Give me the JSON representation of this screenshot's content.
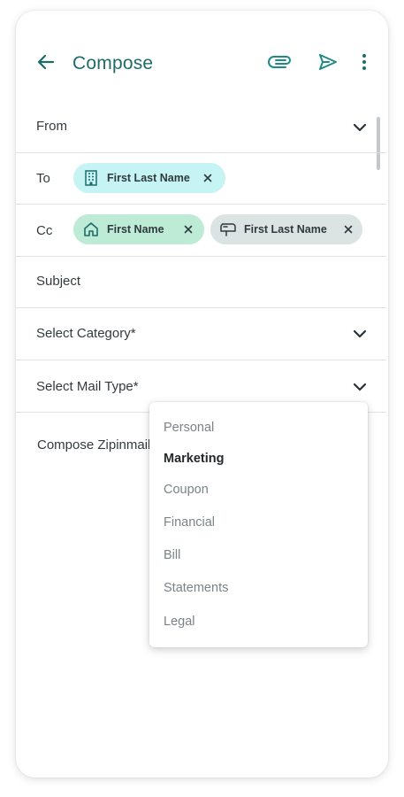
{
  "header": {
    "title": "Compose",
    "back_icon": "arrow-left-icon",
    "attach_icon": "paperclip-icon",
    "send_icon": "send-icon",
    "more_icon": "more-vertical-icon",
    "accent_color": "#1f8a86"
  },
  "fields": {
    "from": {
      "label": "From"
    },
    "to": {
      "label": "To",
      "chips": [
        {
          "name": "First Last Name",
          "icon": "building-icon",
          "color": "#c6f3f4"
        }
      ]
    },
    "cc": {
      "label": "Cc",
      "chips": [
        {
          "name": "First Name",
          "icon": "home-icon",
          "color": "#bdebd6"
        },
        {
          "name": "First Last Name",
          "icon": "mailbox-icon",
          "color": "#dbe3e3"
        }
      ]
    },
    "subject": {
      "label": "Subject"
    },
    "category": {
      "label": "Select Category*"
    },
    "mail_type": {
      "label": "Select Mail Type*"
    }
  },
  "body": {
    "placeholder": "Compose Zipinmail"
  },
  "mail_type_menu": {
    "options": [
      "Personal",
      "Marketing",
      "Coupon",
      "Financial",
      "Bill",
      "Statements",
      "Legal"
    ],
    "selected": "Marketing"
  }
}
